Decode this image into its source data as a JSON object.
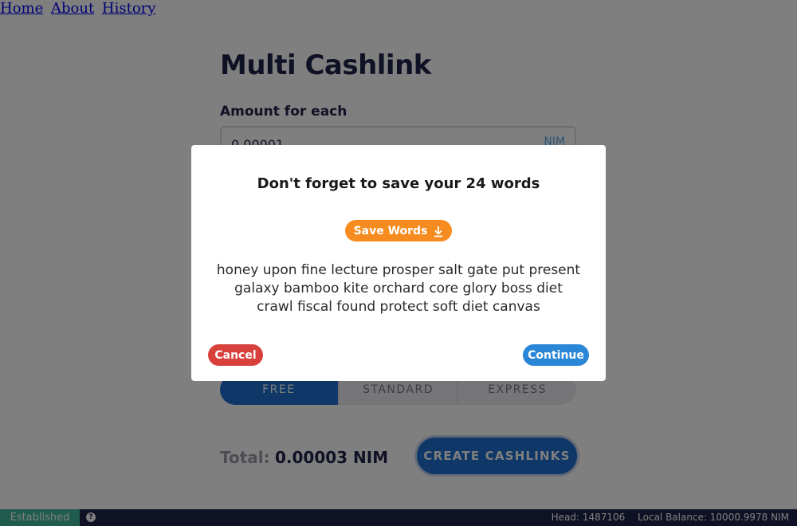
{
  "nav": {
    "links": [
      "Home",
      "About",
      "History"
    ]
  },
  "page": {
    "title": "Multi Cashlink",
    "amount_label": "Amount for each",
    "amount_value": "0.00001",
    "amount_unit": "NIM",
    "fee_options": [
      "FREE",
      "STANDARD",
      "EXPRESS"
    ],
    "fee_selected": "FREE",
    "total_label": "Total:",
    "total_value": "0.00003 NIM",
    "create_button": "CREATE CASHLINKS"
  },
  "modal": {
    "title": "Don't forget to save your 24 words",
    "save_button": "Save Words",
    "save_icon": "download-icon",
    "words": "honey upon fine lecture prosper salt gate put present galaxy bamboo kite orchard core glory boss diet crawl fiscal found protect soft diet canvas",
    "cancel_button": "Cancel",
    "continue_button": "Continue"
  },
  "status": {
    "connection": "Established",
    "help_icon": "?",
    "head": "Head: 1487106",
    "balance": "Local Balance: 10000.9978 NIM"
  },
  "colors": {
    "primary": "#1f2348",
    "accent_blue": "#2a86d6",
    "orange": "#f68c1f",
    "red": "#d8403c",
    "green": "#3fb89a"
  }
}
